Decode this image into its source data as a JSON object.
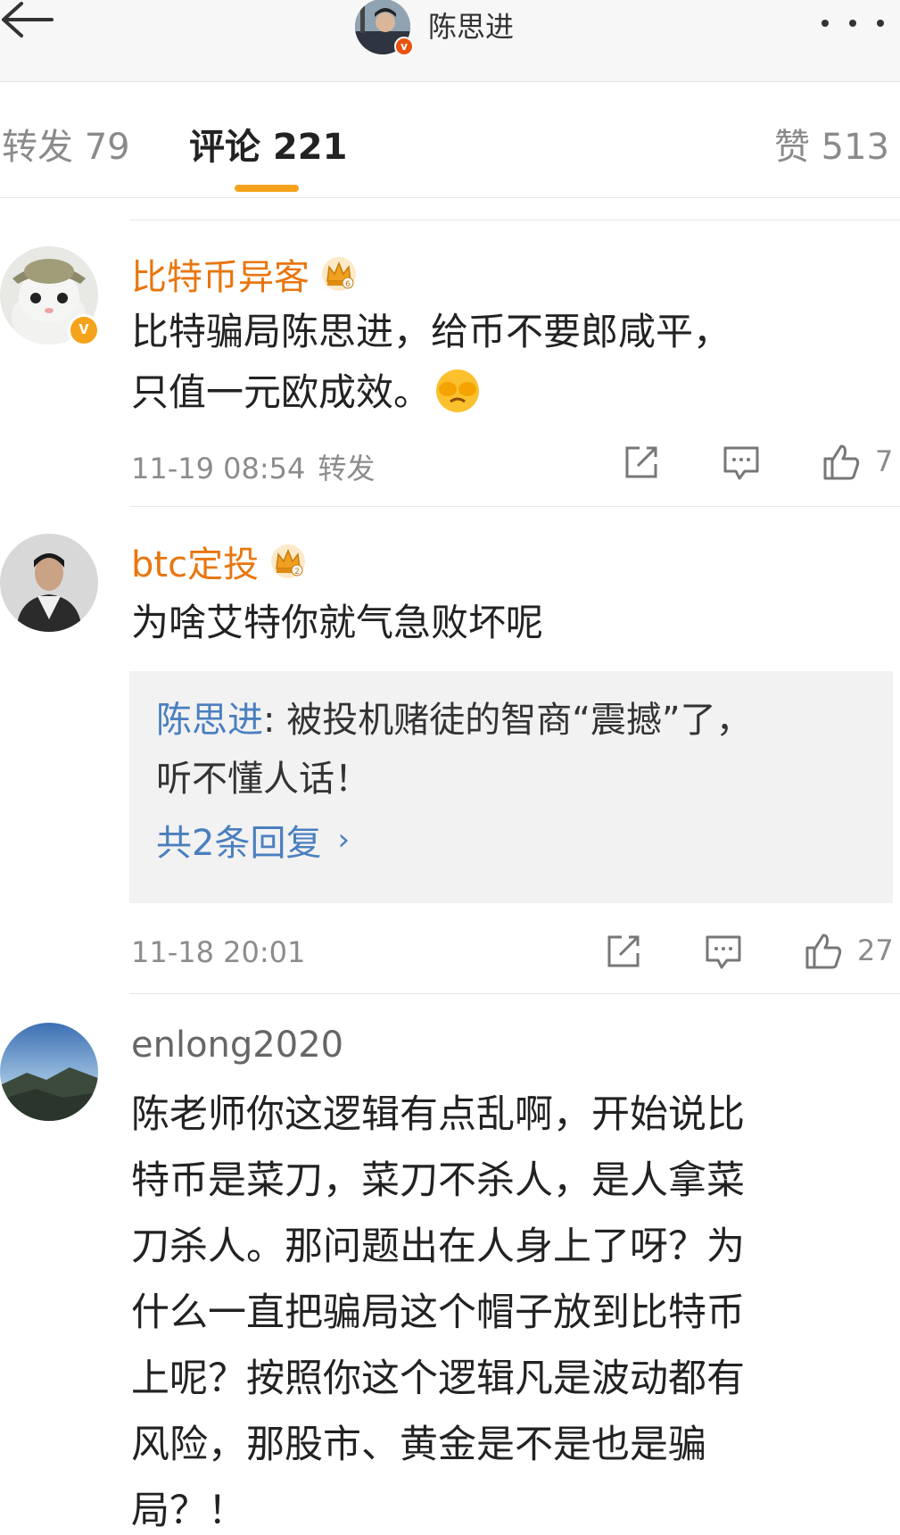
{
  "header": {
    "title": "陈思进",
    "back_icon": "arrow-left-icon",
    "more_icon": "more-dots-icon"
  },
  "tabs": [
    {
      "label": "转发 79",
      "active": false
    },
    {
      "label": "评论 221",
      "active": true
    },
    {
      "label": "赞 513",
      "active": false
    }
  ],
  "colors": {
    "accent": "#f5a31a",
    "username": "#e8760f",
    "link": "#4a7fbf"
  },
  "comments": [
    {
      "username": "比特币异客",
      "text_line1": "比特骗局陈思进，给币不要郎咸平，",
      "text_line2": "只值一元欧成效。",
      "emoji": "face-covering-eyes-emoji",
      "time": "11-19 08:54",
      "forward_label": "转发",
      "likes": "7"
    },
    {
      "username": "btc定投",
      "text": "为啥艾特你就气急败坏呢",
      "reply_author": "陈思进",
      "reply_text_1": ": 被投机赌徒的智商“震撼”了，",
      "reply_text_2": "听不懂人话！",
      "reply_more": "共2条回复",
      "time": "11-18 20:01",
      "likes": "27"
    },
    {
      "username": "enlong2020",
      "lines": [
        "陈老师你这逻辑有点乱啊，开始说比",
        "特币是菜刀，菜刀不杀人，是人拿菜",
        "刀杀人。那问题出在人身上了呀？为",
        "什么一直把骗局这个帽子放到比特币",
        "上呢？按照你这个逻辑凡是波动都有",
        "风险，那股市、黄金是不是也是骗",
        "局？！"
      ]
    }
  ]
}
